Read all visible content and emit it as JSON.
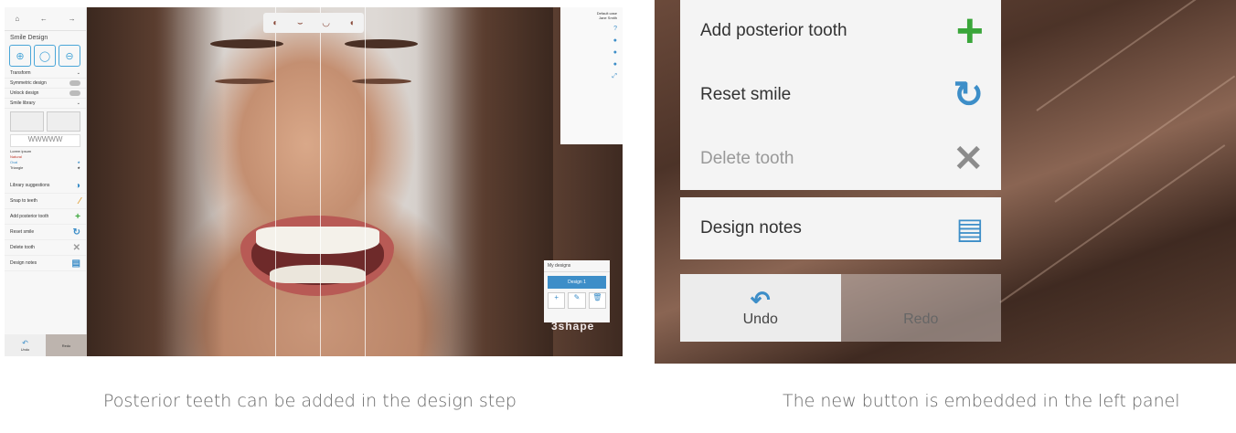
{
  "left_screenshot": {
    "left_panel": {
      "nav": {
        "home_label": "⌂",
        "back_label": "←",
        "forward_label": "→"
      },
      "title": "Smile Design",
      "rows": [
        {
          "label": "Transform"
        },
        {
          "label": "Symmetric design"
        },
        {
          "label": "Unlock design"
        },
        {
          "label": "Smile library"
        }
      ],
      "teeth_strip": "WWWWW",
      "options": [
        {
          "label": "Lorem ipsum"
        },
        {
          "label": "Natural"
        },
        {
          "label": "Oval"
        },
        {
          "label": "Triangle"
        }
      ],
      "actions": [
        {
          "label": "Library suggestions",
          "icon": "info-icon",
          "glyph": "◑",
          "color": "#3d8ec8"
        },
        {
          "label": "Snap to teeth",
          "icon": "magic-wand-icon",
          "glyph": "⁄",
          "color": "#e2a23a"
        },
        {
          "label": "Add posterior tooth",
          "icon": "plus-icon",
          "glyph": "+",
          "color": "#3aa63a"
        },
        {
          "label": "Reset smile",
          "icon": "reset-icon",
          "glyph": "↻",
          "color": "#3d8ec8"
        },
        {
          "label": "Delete tooth",
          "icon": "close-icon",
          "glyph": "✕",
          "color": "#999"
        },
        {
          "label": "Design notes",
          "icon": "notes-icon",
          "glyph": "▤",
          "color": "#3d8ec8"
        }
      ],
      "undo_label": "Undo",
      "redo_label": "Redo"
    },
    "top_icons": [
      "◐",
      "⌣",
      "◡",
      "◖"
    ],
    "right_panel": {
      "name_line1": "Default case",
      "name_line2": "Jane Smith",
      "help": "?"
    },
    "my_designs": {
      "header": "My designs",
      "button": "Design 1",
      "tools": [
        "+",
        "✎",
        "🗑"
      ]
    },
    "brand": "3shape"
  },
  "right_screenshot": {
    "menu": [
      {
        "label": "Add posterior tooth",
        "icon": "plus-icon",
        "glyph": "+",
        "color": "#3aa63a",
        "disabled": false
      },
      {
        "label": "Reset smile",
        "icon": "reset-icon",
        "glyph": "↻",
        "color": "#3d8ec8",
        "disabled": false
      },
      {
        "label": "Delete tooth",
        "icon": "close-icon",
        "glyph": "✕",
        "color": "#8c8c8c",
        "disabled": true
      }
    ],
    "notes": {
      "label": "Design notes",
      "icon": "notes-icon",
      "glyph": "▤",
      "color": "#3d8ec8"
    },
    "undo": {
      "label": "Undo",
      "icon": "undo-icon",
      "glyph": "↶",
      "color": "#3d8ec8"
    },
    "redo": {
      "label": "Redo"
    }
  },
  "captions": {
    "left": "Posterior teeth can be added in the design step",
    "right": "The new button  is embedded in the  left panel"
  }
}
